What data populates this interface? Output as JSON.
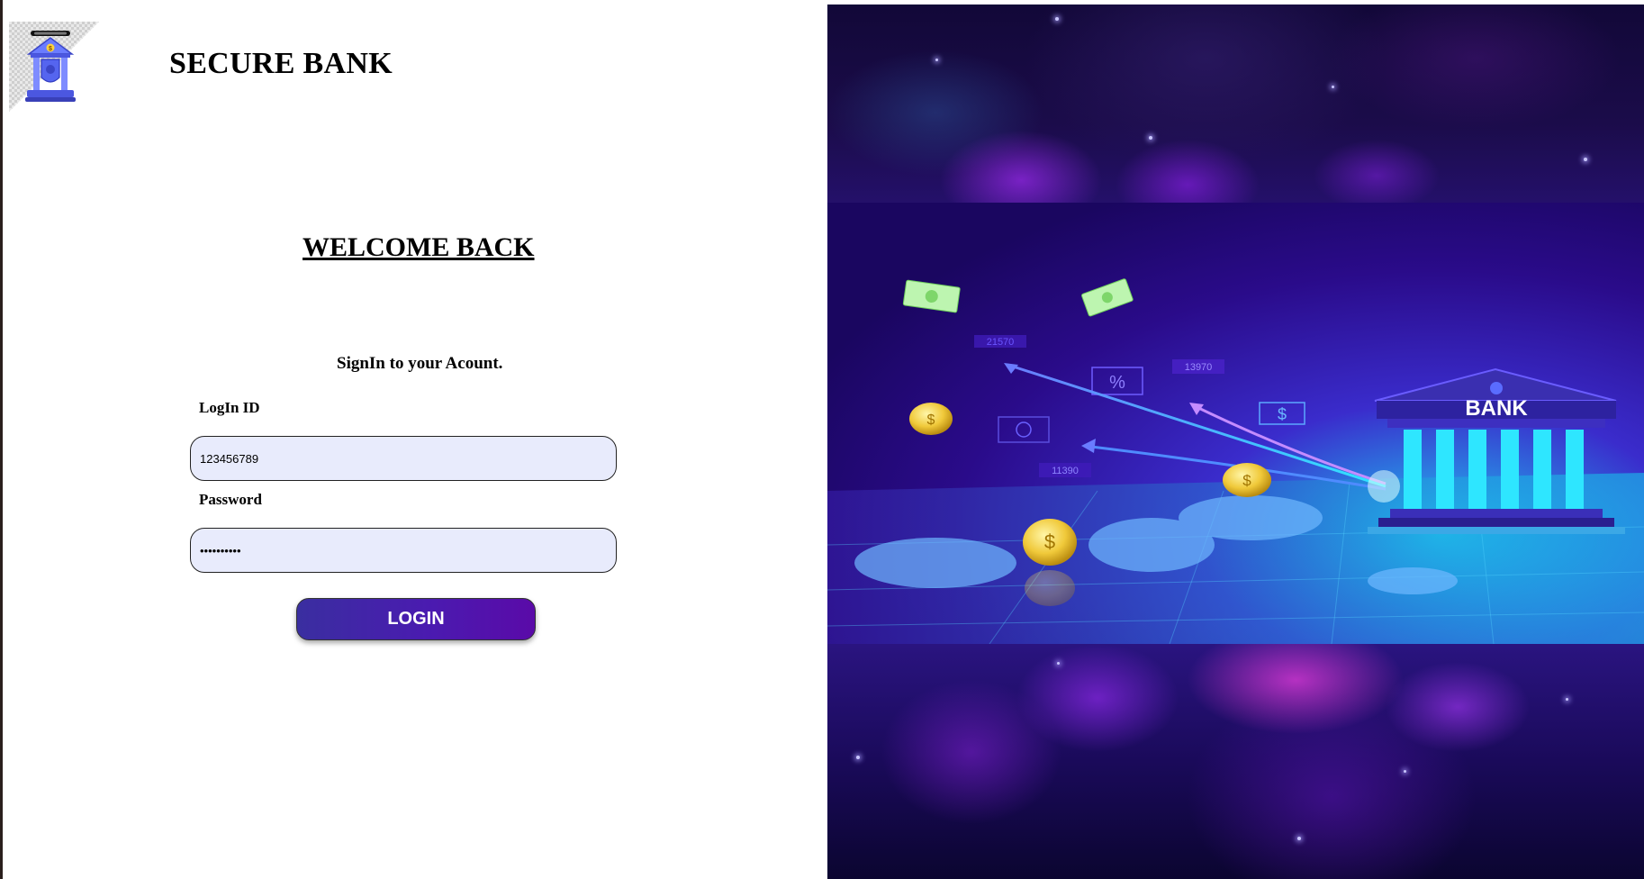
{
  "header": {
    "brand": "SECURE BANK",
    "logo_icon": "bank-shield-icon"
  },
  "login": {
    "heading": "WELCOME BACK",
    "subtitle": "SignIn to your Acount.",
    "id_label": "LogIn ID",
    "id_value": "123456789",
    "password_label": "Password",
    "password_value": "••••••••••",
    "button_label": "LOGIN"
  },
  "banner": {
    "bank_sign": "BANK",
    "numbers": [
      "13970",
      "11390",
      "21570"
    ],
    "symbols": [
      "%",
      "$"
    ],
    "colors": {
      "button_start": "#3a2ea0",
      "button_end": "#5a0aa8",
      "input_bg": "#e8ebfc",
      "banner_bg": "#2a0b8a",
      "bank_cyan": "#2ee6ff"
    }
  }
}
